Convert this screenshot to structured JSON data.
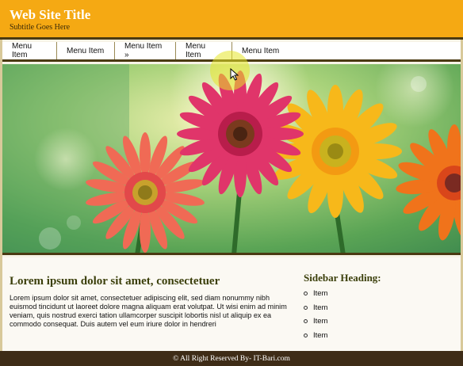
{
  "site": {
    "title": "Web Site Title",
    "subtitle": "Subtitle Goes Here"
  },
  "nav": {
    "items": [
      {
        "label": "Menu Item"
      },
      {
        "label": "Menu Item"
      },
      {
        "label": "Menu Item »"
      },
      {
        "label": "Menu Item"
      },
      {
        "label": "Menu Item"
      }
    ]
  },
  "hero": {
    "image": "gerbera-flowers-banner",
    "colors": {
      "bg_green": "#7fb75a",
      "pink": "#e0356a",
      "coral": "#f06a55",
      "yellow": "#f7b81a",
      "orange": "#f0731b"
    }
  },
  "main": {
    "heading": "Lorem ipsum dolor sit amet, consectetuer",
    "text": "Lorem ipsum dolor sit amet, consectetuer adipiscing elit, sed diam nonummy nibh euismod tincidunt ut laoreet dolore magna aliquam erat volutpat. Ut wisi enim ad minim veniam, quis nostrud exerci tation ullamcorper suscipit lobortis nisl ut aliquip ex ea commodo consequat. Duis autem vel eum iriure dolor in hendreri"
  },
  "sidebar": {
    "heading": "Sidebar Heading:",
    "items": [
      {
        "label": "Item"
      },
      {
        "label": "Item"
      },
      {
        "label": "Item"
      },
      {
        "label": "Item"
      }
    ]
  },
  "footer": {
    "text": "© All Right Reserved By- IT-Bari.com"
  },
  "theme": {
    "header": "#f5a913",
    "dark_border": "#4a3a12",
    "footer": "#3e2c17",
    "heading_text": "#3b3f0b"
  }
}
